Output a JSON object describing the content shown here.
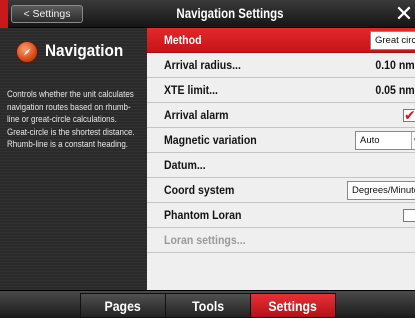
{
  "header": {
    "back_label": "< Settings",
    "title": "Navigation Settings",
    "close_label": "✕"
  },
  "left_panel": {
    "icon": "compass-icon",
    "title": "Navigation",
    "description": "Controls whether the unit calculates navigation routes based on rhumb-line or great-circle calculations. Great-circle is the shortest distance. Rhumb-line is a constant heading."
  },
  "settings": {
    "method": {
      "label": "Method",
      "value": "Great circle"
    },
    "arrival_radius": {
      "label": "Arrival radius...",
      "value": "0.10 nm"
    },
    "xte_limit": {
      "label": "XTE limit...",
      "value": "0.05 nm"
    },
    "arrival_alarm": {
      "label": "Arrival alarm",
      "checked": true
    },
    "magnetic_variation": {
      "label": "Magnetic variation",
      "value": "Auto"
    },
    "datum": {
      "label": "Datum..."
    },
    "coord_system": {
      "label": "Coord system",
      "value": "Degrees/Minutes"
    },
    "phantom_loran": {
      "label": "Phantom Loran",
      "checked": false
    },
    "loran_settings": {
      "label": "Loran settings..."
    }
  },
  "bottom_tabs": {
    "pages": "Pages",
    "tools": "Tools",
    "settings": "Settings",
    "active": "Settings"
  },
  "colors": {
    "accent": "#d21c20",
    "list_bg": "#efefef",
    "panel_bg": "#2a2a2a"
  }
}
